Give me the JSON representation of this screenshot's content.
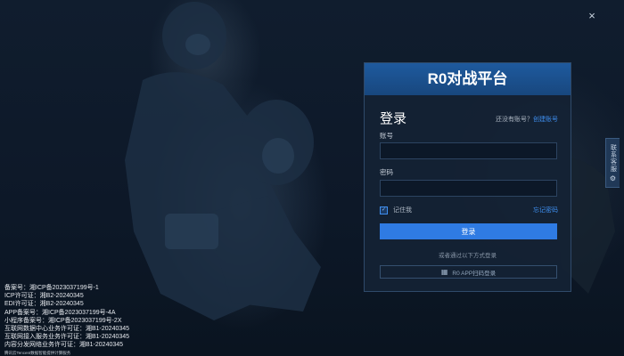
{
  "window": {
    "close_icon": "×"
  },
  "card": {
    "title": "R0对战平台",
    "login_title": "登录",
    "no_account_text": "还没有账号？",
    "create_account_link": "创建账号",
    "account_label": "账号",
    "account_value": "",
    "password_label": "密码",
    "password_value": "",
    "remember_label": "记住我",
    "remember_checked": true,
    "forgot_link": "忘记密码",
    "login_button": "登录",
    "other_methods_text": "或者通过以下方式登录",
    "qr_login_button": "R0 APP扫码登录"
  },
  "side_tab": {
    "label": "联系客服"
  },
  "footer": {
    "lines": [
      "备案号：湘ICP备2023037199号-1",
      "ICP许可证：湘B2-20240345",
      "EDI许可证：湘B2-20240345",
      "APP备案号：湘ICP备2023037199号-4A",
      "小程序备案号：湘ICP备2023037199号-2X",
      "互联网数据中心业务许可证：湘B1-20240345",
      "互联网接入服务业务许可证：湘B1-20240345",
      "内容分发网络业务许可证：湘B1-20240345"
    ],
    "small_line": "腾讯云Tencent数据智能提供计算服务"
  },
  "colors": {
    "accent": "#2f7be3",
    "link": "#3e8ff0",
    "header": "#1e5a9e"
  },
  "icons": {
    "close": "close-icon",
    "check": "check-icon",
    "qr": "qr-code-icon",
    "support": "gear-icon"
  }
}
